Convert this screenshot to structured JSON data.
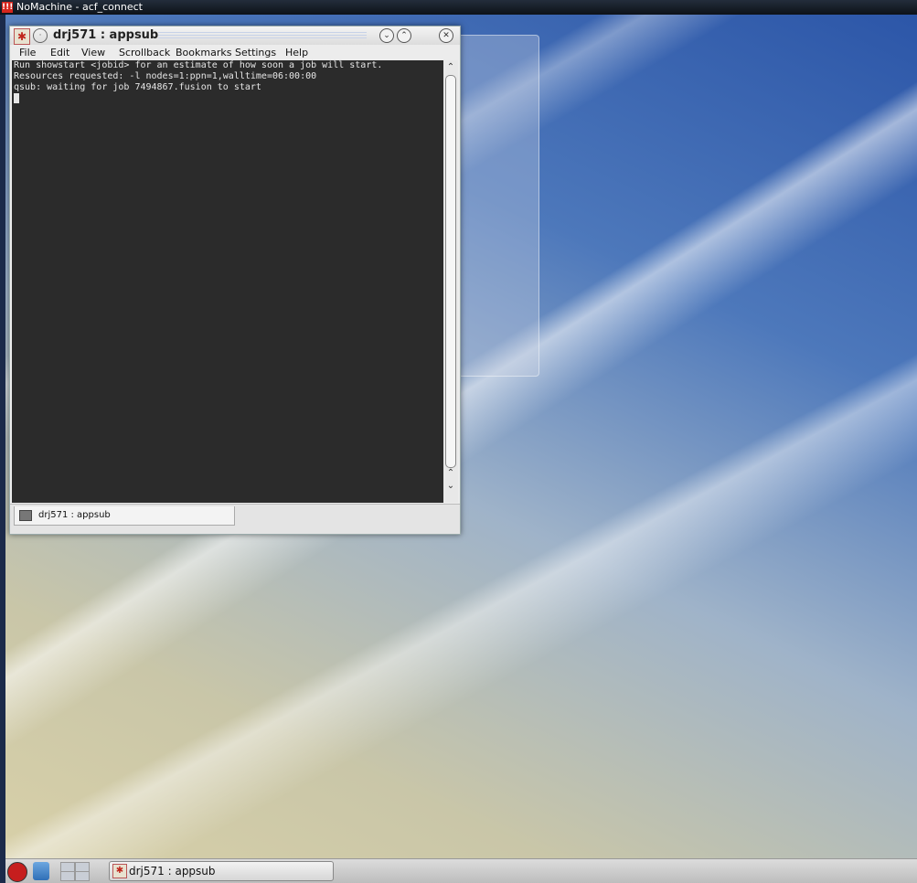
{
  "nx": {
    "title": "NoMachine - acf_connect",
    "logo_text": "!!!"
  },
  "window": {
    "title": "drj571 : appsub",
    "buttons": [
      "minimize",
      "maximize",
      "close"
    ]
  },
  "menu": [
    "File",
    "Edit",
    "View",
    "Scrollback",
    "Bookmarks",
    "Settings",
    "Help"
  ],
  "terminal": {
    "lines": [
      "Run showstart <jobid> for an estimate of how soon a job will start.",
      "Resources requested: -l nodes=1:ppn=1,walltime=06:00:00",
      "qsub: waiting for job 7494867.fusion to start"
    ]
  },
  "tab": {
    "label": "drj571 : appsub"
  },
  "taskbar": {
    "task_label": "drj571 : appsub"
  },
  "icons": {
    "app": "konsole-icon",
    "pin": "pin-icon",
    "minimize": "chevron-down-icon",
    "maximize": "chevron-up-icon",
    "close": "close-icon",
    "redhat": "redhat-logo-icon",
    "finder": "file-manager-icon"
  },
  "colors": {
    "terminal_bg": "#2b2b2b",
    "terminal_fg": "#e6e6e6",
    "redhat": "#c61e1e"
  }
}
